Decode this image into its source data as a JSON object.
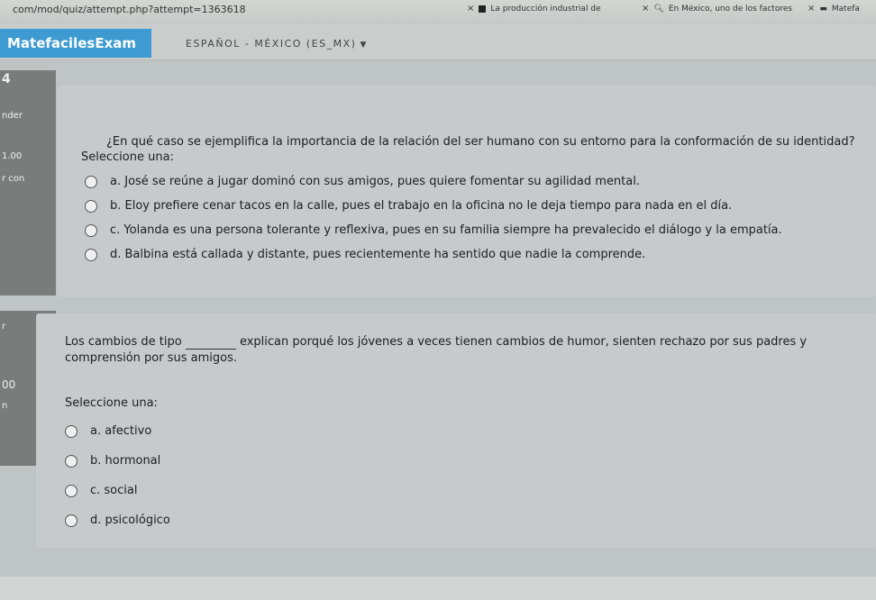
{
  "browser": {
    "url": "com/mod/quiz/attempt.php?attempt=1363618",
    "tabs": [
      {
        "label": "La producción industrial de"
      },
      {
        "label": "En México, uno de los factores"
      },
      {
        "label": "Matefa"
      }
    ]
  },
  "navbar": {
    "brand": "MatefacilesExam",
    "language": "ESPAÑOL - MÉXICO (ES_MX)"
  },
  "left_panel_1": {
    "number": "4",
    "line1": "nder",
    "line2": "1.00",
    "line3": "r con"
  },
  "left_panel_2": {
    "line1": "r",
    "line2": "00",
    "line3": "n"
  },
  "question1": {
    "text": "¿En qué caso se ejemplifica la importancia de la relación del ser humano con su entorno para la conformación de su identidad?",
    "select_label": "Seleccione una:",
    "options": [
      "a. José se reúne a jugar dominó con sus  amigos, pues quiere fomentar su agilidad mental.",
      "b. Eloy prefiere cenar tacos en la calle, pues el trabajo en la oficina no le deja tiempo para nada en el día.",
      "c. Yolanda es una persona tolerante y reflexiva, pues en su familia siempre ha prevalecido el diálogo y la empatía.",
      "d. Balbina está callada y distante, pues recientemente ha sentido que nadie la comprende."
    ]
  },
  "question2": {
    "text_before": "Los cambios de tipo",
    "text_after": "explican porqué los jóvenes a veces tienen cambios de humor, sienten rechazo por sus padres y",
    "text_line2": "comprensión por sus amigos.",
    "select_label": "Seleccione una:",
    "options": [
      "a. afectivo",
      "b. hormonal",
      "c. social",
      "d. psicológico"
    ]
  }
}
